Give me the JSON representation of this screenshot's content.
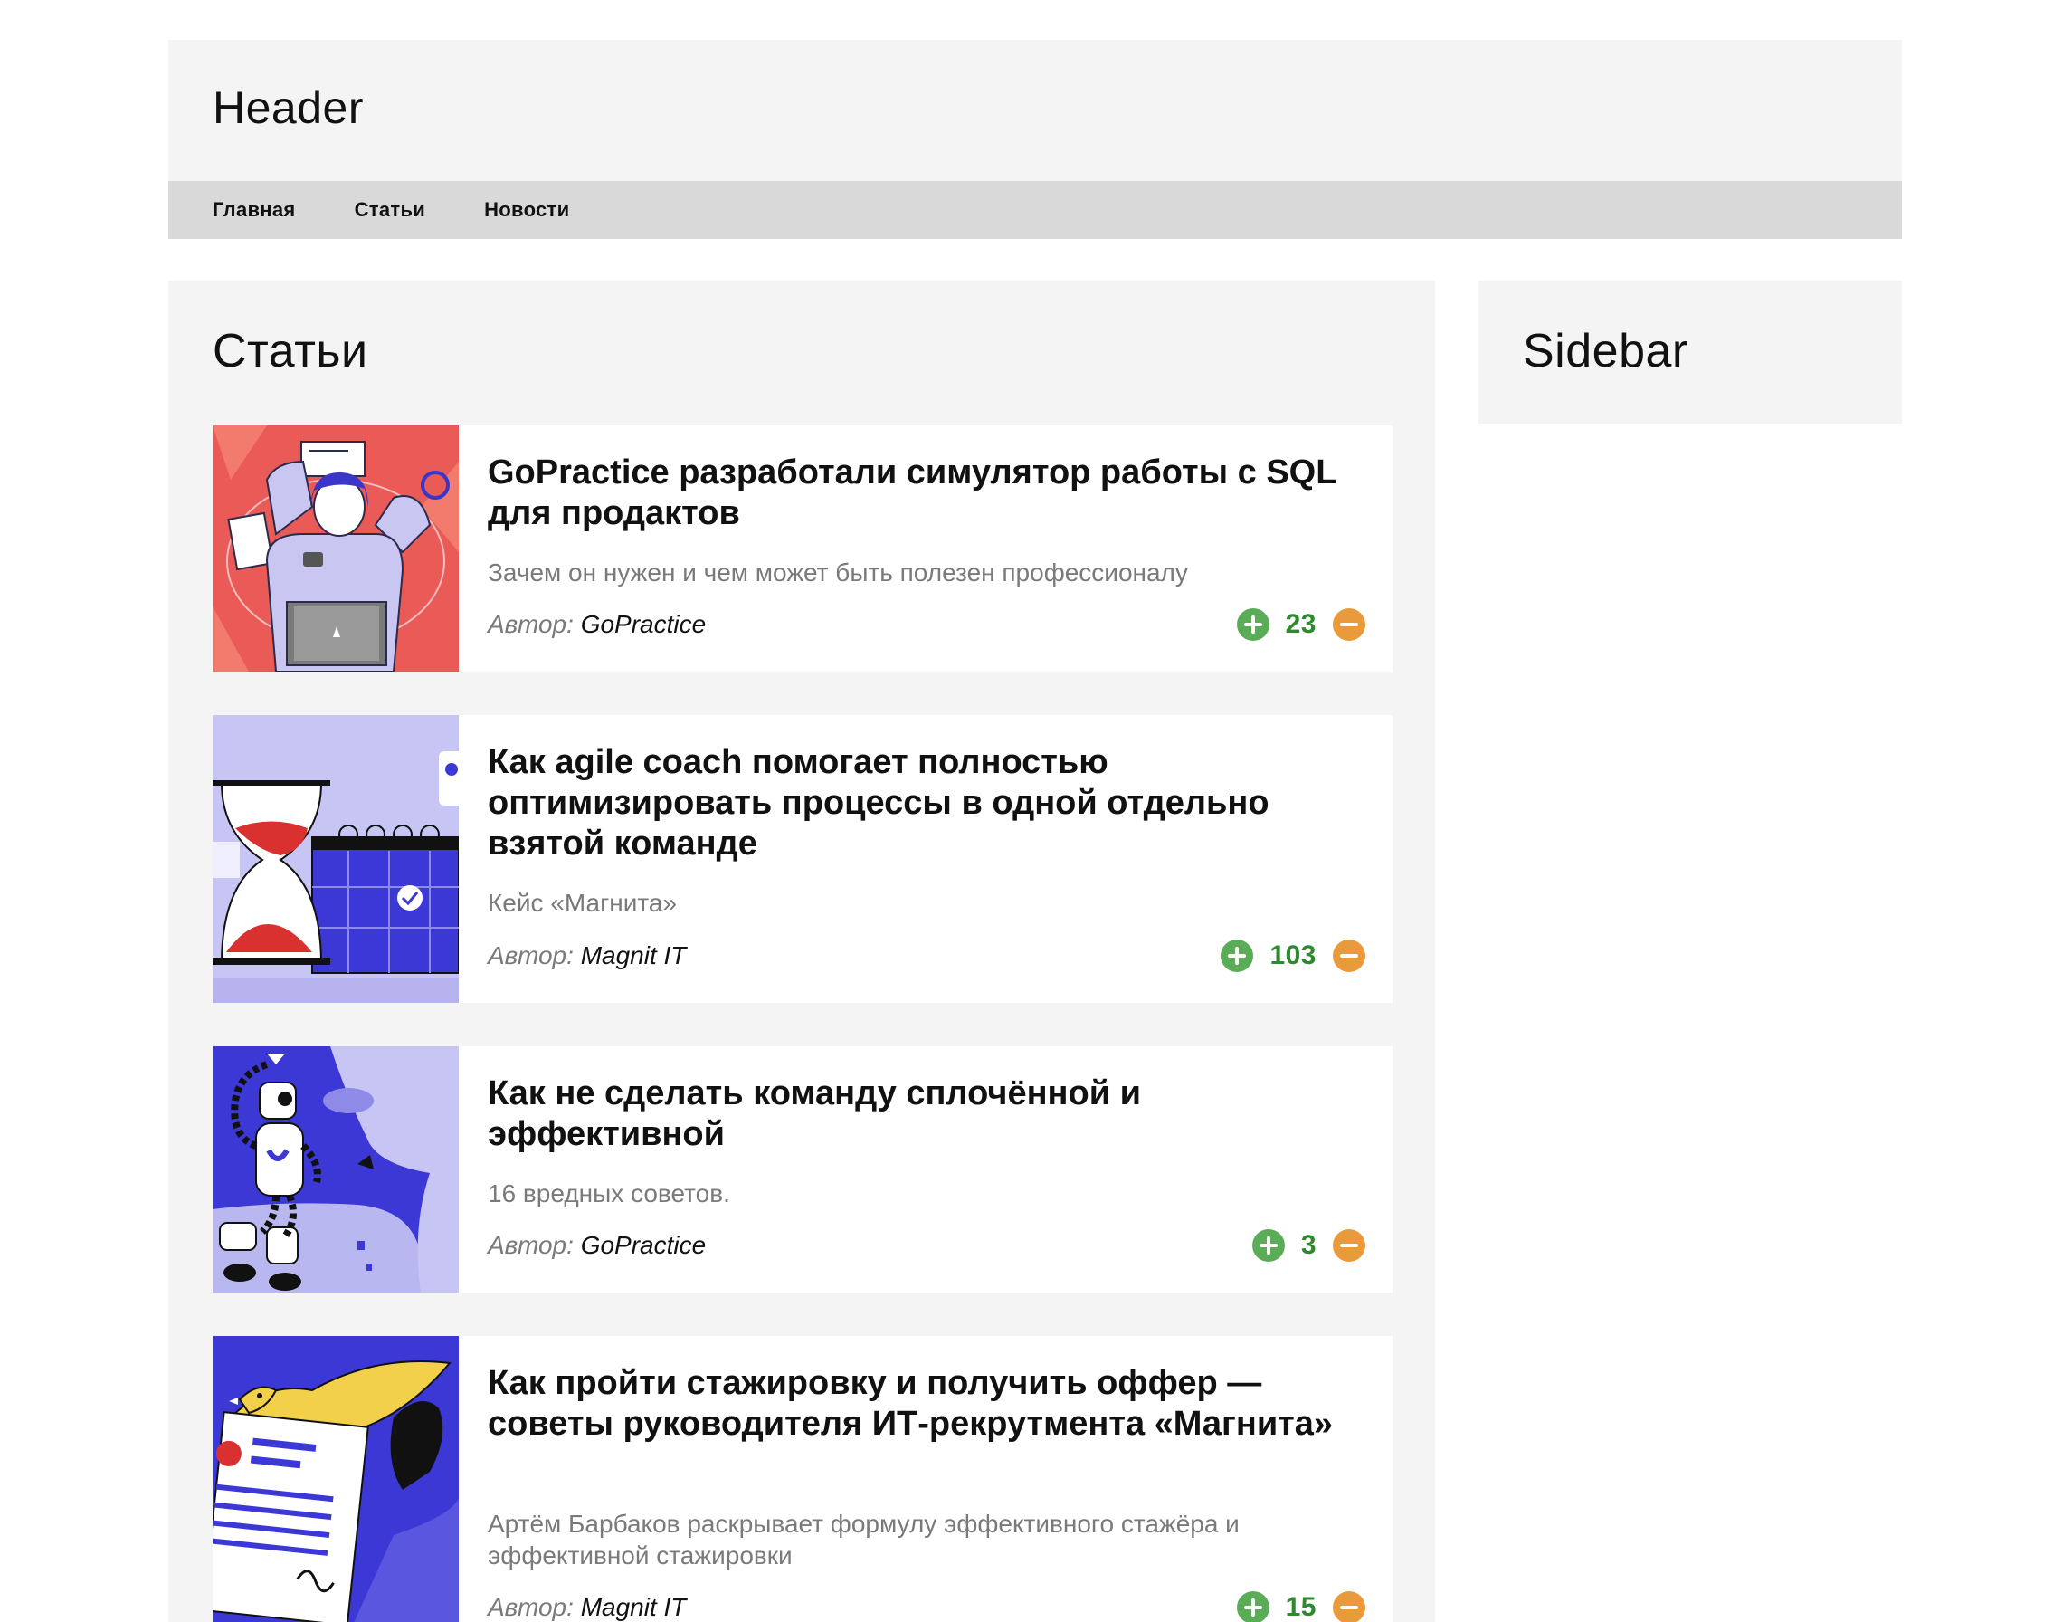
{
  "header": {
    "title": "Header"
  },
  "nav": {
    "items": [
      {
        "label": "Главная"
      },
      {
        "label": "Статьи"
      },
      {
        "label": "Новости"
      }
    ]
  },
  "main": {
    "title": "Статьи"
  },
  "sidebar": {
    "title": "Sidebar"
  },
  "articles": [
    {
      "title": "GoPractice разработали симулятор работы с SQL для продактов",
      "description": "Зачем он нужен и чем может быть полезен профессионалу",
      "author_label": "Автор:",
      "author": "GoPractice",
      "votes": "23",
      "image_icon": "woman-multitasking-illustration"
    },
    {
      "title": "Как agile coach помогает полностью оптимизировать процессы в одной отдельно взятой команде",
      "description": "Кейс «Магнита»",
      "author_label": "Автор:",
      "author": "Magnit IT",
      "votes": "103",
      "image_icon": "hourglass-calendar-illustration"
    },
    {
      "title": "Как не сделать команду сплочённой и эффективной",
      "description": "16 вредных советов.",
      "author_label": "Автор:",
      "author": "GoPractice",
      "votes": "3",
      "image_icon": "robot-astronaut-illustration"
    },
    {
      "title": "Как пройти стажировку и получить оффер — советы руководителя ИТ-рекрутмента «Магнита»",
      "description": "Артём Барбаков раскрывает формулу эффективного стажёра и эффективной стажировки",
      "author_label": "Автор:",
      "author": "Magnit IT",
      "votes": "15",
      "image_icon": "bird-document-illustration"
    }
  ],
  "colors": {
    "vote_up": "#5aac57",
    "vote_down": "#e99a3b",
    "vote_count": "#2f8a2f",
    "panel_bg": "#f4f4f4",
    "nav_bg": "#d9d9d9"
  }
}
